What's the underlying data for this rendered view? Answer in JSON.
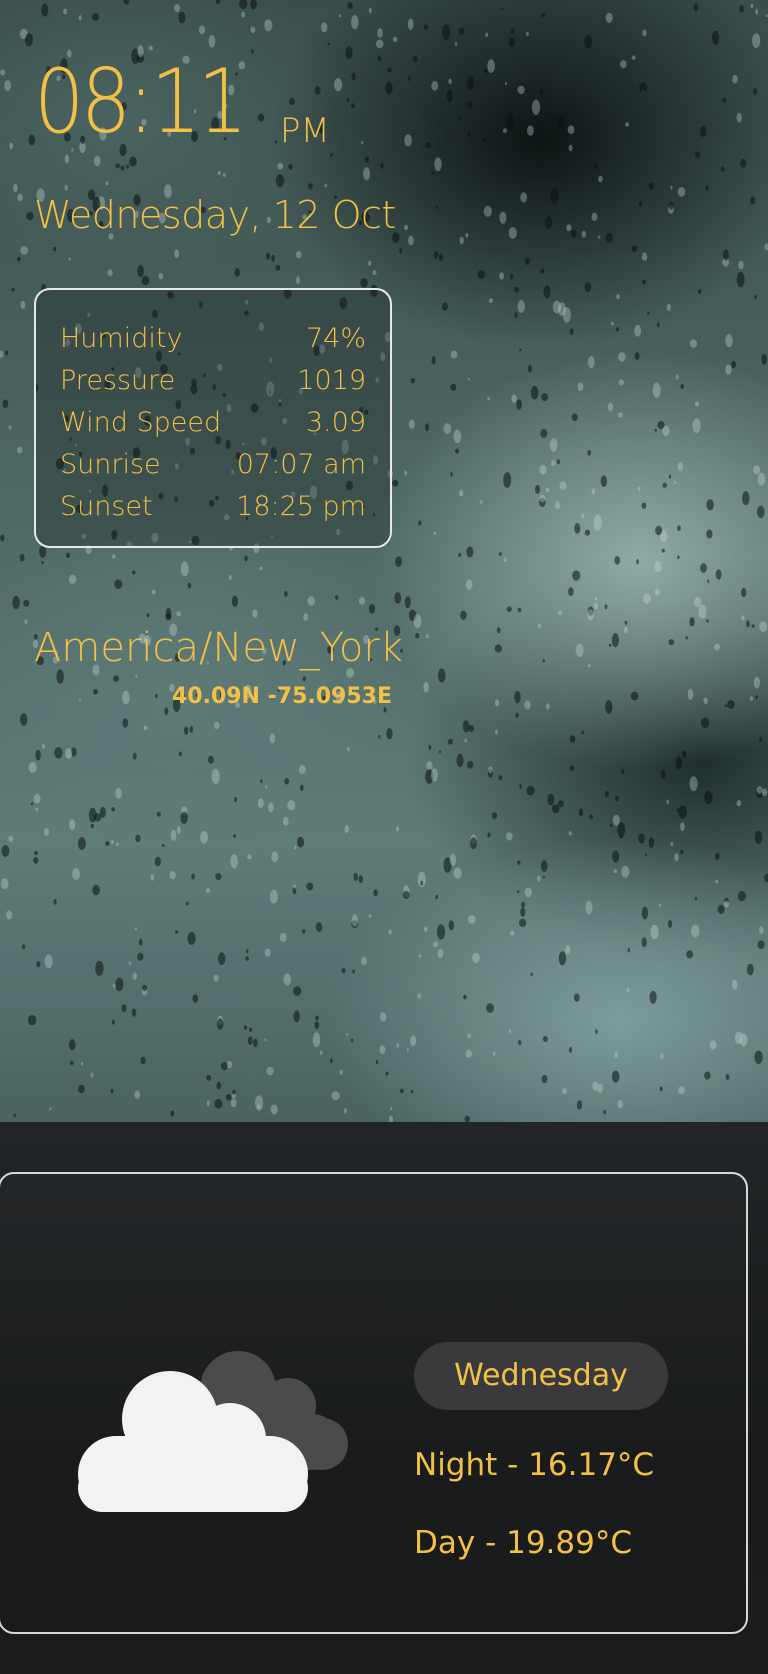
{
  "clock": {
    "time": "08:11",
    "period": "PM",
    "date": "Wednesday, 12 Oct"
  },
  "stats": [
    {
      "label": "Humidity",
      "value": "74%"
    },
    {
      "label": "Pressure",
      "value": "1019"
    },
    {
      "label": "Wind Speed",
      "value": "3.09"
    },
    {
      "label": "Sunrise",
      "value": "07:07 am"
    },
    {
      "label": "Sunset",
      "value": "18:25 pm"
    }
  ],
  "location": {
    "timezone": "America/New_York",
    "coordinates": "40.09N -75.0953E"
  },
  "forecast": {
    "day": "Wednesday",
    "night": "Night - 16.17°C",
    "daytime": "Day - 19.89°C",
    "icon": "cloudy-icon"
  },
  "colors": {
    "accent": "#f1c045",
    "pill": "#3a3a3d",
    "border": "#e8e8e8"
  }
}
